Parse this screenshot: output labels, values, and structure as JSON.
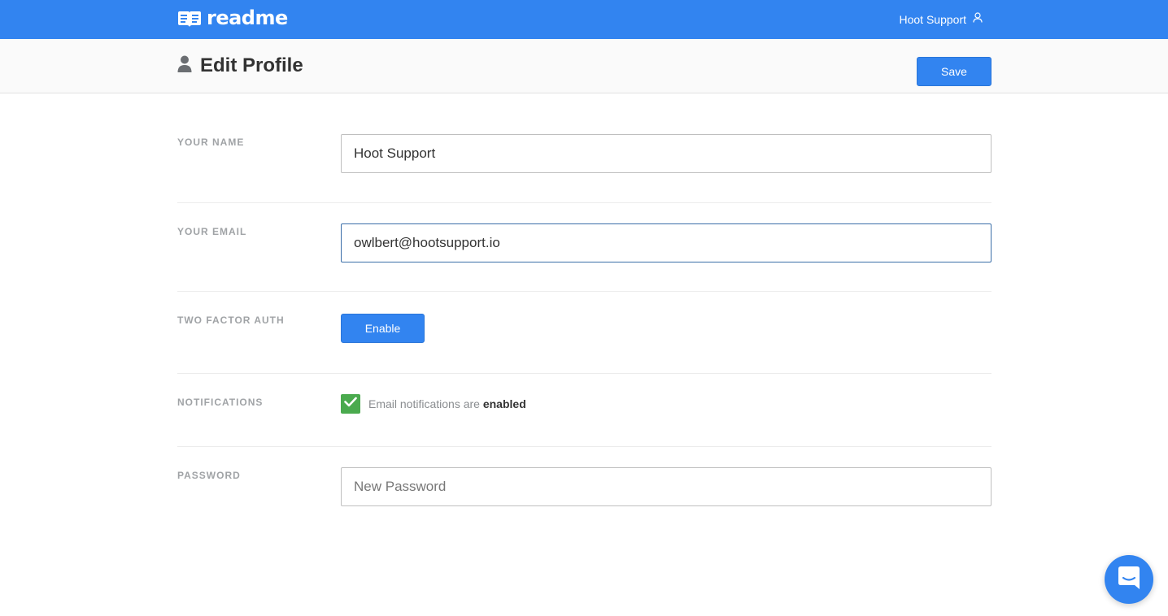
{
  "header": {
    "logo_text": "readme",
    "user_name": "Hoot Support"
  },
  "subheader": {
    "title": "Edit Profile",
    "save_label": "Save"
  },
  "form": {
    "name": {
      "label": "YOUR NAME",
      "value": "Hoot Support"
    },
    "email": {
      "label": "YOUR EMAIL",
      "value": "owlbert@hootsupport.io"
    },
    "two_factor": {
      "label": "TWO FACTOR AUTH",
      "button_label": "Enable"
    },
    "notifications": {
      "label": "NOTIFICATIONS",
      "checked": true,
      "text_prefix": "Email notifications are",
      "text_state": "enabled"
    },
    "password": {
      "label": "PASSWORD",
      "value": "",
      "placeholder": "New Password"
    }
  },
  "colors": {
    "brand": "#3284f0",
    "checkbox": "#4aaa4e"
  },
  "icons": {
    "logo": "book-icon",
    "user": "user-icon",
    "page": "person-icon",
    "check": "check-icon",
    "chat": "chat-icon"
  }
}
